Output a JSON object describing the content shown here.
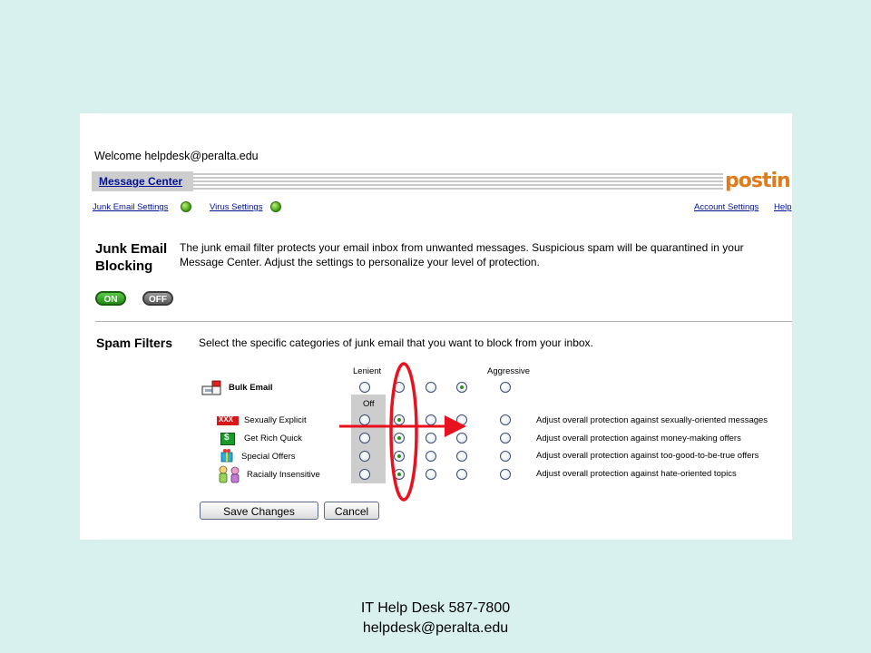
{
  "welcome": "Welcome helpdesk@peralta.edu",
  "nav": {
    "message_center": "Message Center",
    "logo_text": "postin",
    "junk_settings": "Junk Email Settings",
    "virus_settings": "Virus Settings",
    "account_settings": "Account Settings",
    "help": "Help"
  },
  "junk": {
    "heading_line1": "Junk Email",
    "heading_line2": "Blocking",
    "desc_line1": "The junk email filter protects your email inbox from unwanted messages. Suspicious spam will be quarantined in your",
    "desc_line2": "Message Center. Adjust the settings to personalize your level of protection.",
    "on_label": "ON",
    "off_label": "OFF",
    "state": "ON"
  },
  "spam": {
    "heading": "Spam Filters",
    "desc": "Select the specific categories of junk email that you want to block from your inbox.",
    "lenient_label": "Lenient",
    "aggressive_label": "Aggressive",
    "off_label": "Off",
    "bulk": {
      "label": "Bulk Email",
      "selected_level": 4
    },
    "categories": [
      {
        "label": "Sexually Explicit",
        "icon": "xxx-icon",
        "selected_level": 2,
        "note": "Adjust overall protection against sexually-oriented messages"
      },
      {
        "label": "Get Rich Quick",
        "icon": "money-icon",
        "selected_level": 2,
        "note": "Adjust overall protection against money-making offers"
      },
      {
        "label": "Special Offers",
        "icon": "gift-icon",
        "selected_level": 2,
        "note": "Adjust overall protection against too-good-to-be-true offers"
      },
      {
        "label": "Racially Insensitive",
        "icon": "people-icon",
        "selected_level": 2,
        "note": "Adjust overall protection against hate-oriented topics"
      }
    ]
  },
  "buttons": {
    "save": "Save Changes",
    "cancel": "Cancel"
  },
  "annotation_color": "#e8121e",
  "footer": {
    "line1": "IT Help Desk   587-7800",
    "line2": "helpdesk@peralta.edu"
  }
}
